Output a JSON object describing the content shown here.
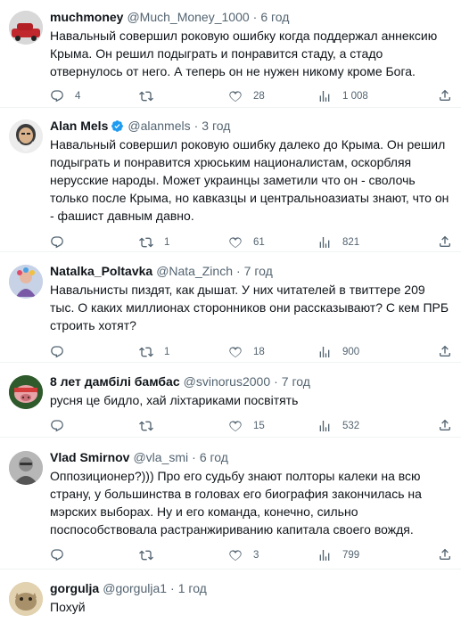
{
  "tweets": [
    {
      "name": "muchmoney",
      "handle": "@Much_Money_1000",
      "time": "6 год",
      "text": "Навальный совершил роковую ошибку когда поддержал аннексию Крыма. Он решил подыграть и понравится стаду, а стадо отвернулось от него. А теперь он не нужен никому кроме Бога.",
      "replies": "4",
      "retweets": "",
      "likes": "28",
      "views": "1 008",
      "verified": false
    },
    {
      "name": "Alan Mels",
      "handle": "@alanmels",
      "time": "3 год",
      "text": "Навальный совершил роковую ошибку далеко до Крыма. Он решил подыграть и понравится хрюським националистам, оскорбляя нерусские народы. Может украинцы заметили что он - сволочь только после Крыма, но кавказцы и центральноазиаты знают, что он - фашист давным давно.",
      "replies": "",
      "retweets": "1",
      "likes": "61",
      "views": "821",
      "verified": true
    },
    {
      "name": "Natalka_Poltavka",
      "handle": "@Nata_Zinch",
      "time": "7 год",
      "text": "Навальнисты пиздят, как дышат. У них читателей в твиттере 209 тыс. О каких миллионах сторонников они рассказывают? С кем ПРБ строить хотят?",
      "replies": "",
      "retweets": "1",
      "likes": "18",
      "views": "900",
      "verified": false
    },
    {
      "name": "8 лет дамбілі бамбас",
      "handle": "@svinorus2000",
      "time": "7 год",
      "text": "русня це бидло, хай ліхтариками посвітять",
      "replies": "",
      "retweets": "",
      "likes": "15",
      "views": "532",
      "verified": false
    },
    {
      "name": "Vlad Smirnov",
      "handle": "@vla_smi",
      "time": "6 год",
      "text": "Оппозиционер?))) Про его судьбу знают полторы калеки на всю страну, у большинства в головах его биография закончилась на мэрских выборах. Ну и его команда, конечно, сильно поспособствовала растранжириванию капитала своего вождя.",
      "replies": "",
      "retweets": "",
      "likes": "3",
      "views": "799",
      "verified": false
    },
    {
      "name": "gorgulja",
      "handle": "@gorgulja1",
      "time": "1 год",
      "text": "Похуй",
      "replies": "",
      "retweets": "",
      "likes": "",
      "views": "",
      "verified": false
    }
  ],
  "colors": {
    "accent": "#1d9bf0",
    "muted": "#536471",
    "text": "#0f1419",
    "divider": "#eff3f4"
  },
  "icons": {
    "reply": "reply-icon",
    "retweet": "retweet-icon",
    "like": "heart-icon",
    "views": "views-icon",
    "share": "share-icon",
    "verified": "verified-badge-icon"
  }
}
